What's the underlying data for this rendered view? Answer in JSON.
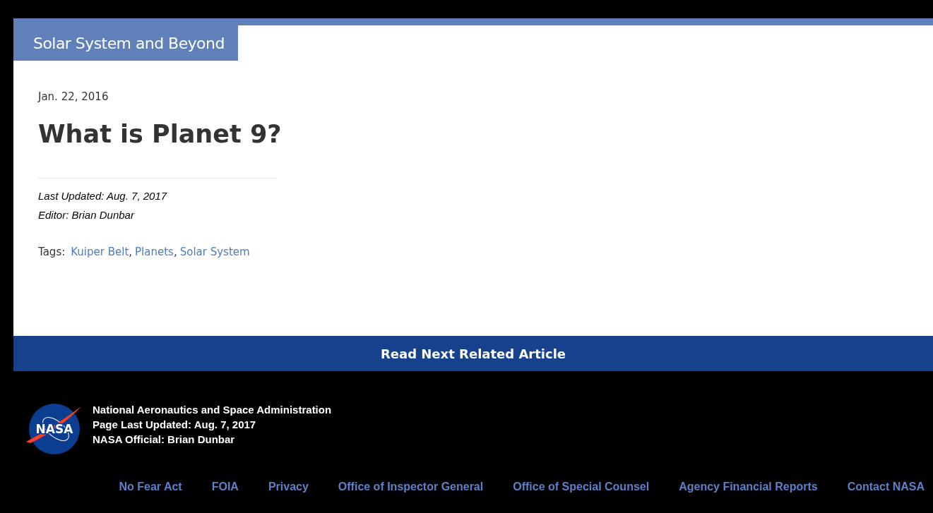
{
  "section_tab": "Solar System and Beyond",
  "article": {
    "date": "Jan. 22, 2016",
    "title": "What is Planet 9?",
    "last_updated": "Last Updated: Aug. 7, 2017",
    "editor": "Editor: Brian Dunbar",
    "tags_label": "Tags:",
    "tags": [
      "Kuiper Belt",
      "Planets",
      "Solar System"
    ],
    "tag_separator": ","
  },
  "read_next_button": "Read Next Related Article",
  "footer": {
    "logo_text": "NASA",
    "lines": [
      "National Aeronautics and Space Administration",
      "Page Last Updated: Aug. 7, 2017",
      "NASA Official: Brian Dunbar"
    ],
    "links": [
      "No Fear Act",
      "FOIA",
      "Privacy",
      "Office of Inspector General",
      "Office of Special Counsel",
      "Agency Financial Reports",
      "Contact NASA"
    ]
  }
}
